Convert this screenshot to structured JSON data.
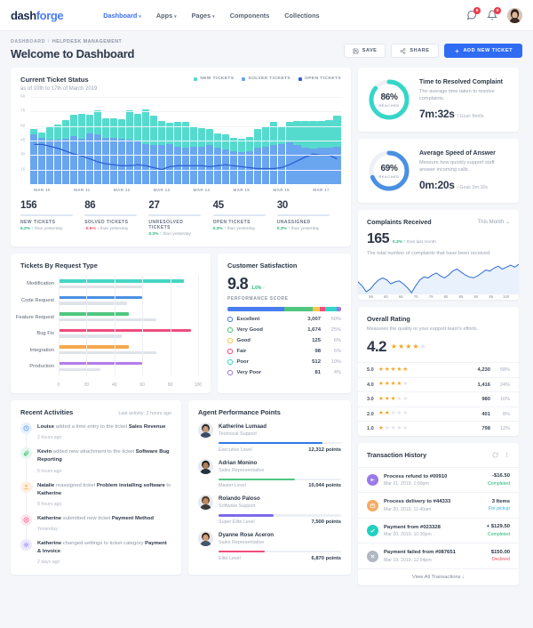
{
  "navbar": {
    "logo_bold": "dash",
    "logo_light": "forge",
    "links": [
      {
        "label": "Dashboard",
        "active": true,
        "caret": true
      },
      {
        "label": "Apps",
        "active": false,
        "caret": true
      },
      {
        "label": "Pages",
        "active": false,
        "caret": true
      },
      {
        "label": "Components",
        "active": false,
        "caret": false
      },
      {
        "label": "Collections",
        "active": false,
        "caret": false
      }
    ],
    "message_badge": "9",
    "bell_badge": "9"
  },
  "page_header": {
    "crumb1": "DASHBOARD",
    "crumb_sep": "/",
    "crumb2": "HELPDESK MANAGEMENT",
    "title": "Welcome to Dashboard",
    "save_label": "SAVE",
    "share_label": "SHARE",
    "add_label": "ADD NEW TICKET"
  },
  "ticket_status": {
    "title": "Current Ticket Status",
    "subtitle": "as of 10th to 17th of March 2019",
    "legend": [
      {
        "label": "NEW TICKETS",
        "color": "#55dbcd"
      },
      {
        "label": "SOLVED TICKETS",
        "color": "#6aa5f0"
      },
      {
        "label": "OPEN TICKETS",
        "color": "#2f5fd0"
      }
    ]
  },
  "chart_data": [
    {
      "type": "bar",
      "title": "Current Ticket Status",
      "subtitle": "as of 10th to 17th of March 2019",
      "xlabel": "",
      "ylabel": "",
      "ylim": [
        0,
        90
      ],
      "yticks": [
        15,
        30,
        45,
        60,
        75,
        90
      ],
      "categories": [
        "MAR 10",
        "MAR 11",
        "MAR 12",
        "MAR 13",
        "MAR 14",
        "MAR 15",
        "MAR 16",
        "MAR 17"
      ],
      "tick_positions": [
        1,
        6,
        11,
        16,
        21,
        26,
        31,
        36
      ],
      "stacked": true,
      "series": [
        {
          "name": "SOLVED TICKETS",
          "color": "#6aa5f0",
          "values": [
            51,
            48,
            46,
            46,
            47,
            50,
            47,
            52,
            51,
            48,
            48,
            47,
            46,
            45,
            41,
            40,
            40,
            41,
            39,
            38,
            39,
            39,
            40,
            38,
            36,
            34,
            33,
            34,
            38,
            39,
            40,
            41,
            43,
            40,
            38,
            37,
            38,
            38,
            39
          ]
        },
        {
          "name": "NEW TICKETS",
          "color": "#55dbcd",
          "values": [
            6,
            5,
            13,
            16,
            19,
            22,
            26,
            20,
            25,
            20,
            20,
            20,
            30,
            28,
            36,
            31,
            25,
            22,
            25,
            26,
            21,
            19,
            17,
            14,
            15,
            14,
            14,
            15,
            19,
            21,
            24,
            19,
            21,
            25,
            27,
            28,
            27,
            28,
            32
          ]
        }
      ],
      "line_series": {
        "name": "OPEN TICKETS",
        "color": "#2f5fd0",
        "values": [
          41,
          41,
          39,
          37,
          34,
          31,
          29,
          26,
          23,
          21,
          20,
          19,
          19,
          20,
          19,
          17,
          15,
          18,
          19,
          19,
          19,
          19,
          18,
          19,
          20,
          19,
          18,
          17,
          16,
          16,
          16,
          17,
          20,
          24,
          28,
          31,
          30,
          30,
          26
        ]
      }
    },
    {
      "type": "line",
      "title": "Complaints Received",
      "xlabel": "",
      "ylabel": "",
      "xticks": [
        "55",
        "60",
        "65",
        "70",
        "75",
        "80",
        "85",
        "90",
        "95",
        "100"
      ],
      "values": [
        48,
        40,
        28,
        33,
        44,
        52,
        56,
        52,
        44,
        48,
        50,
        44,
        36,
        26,
        40,
        52,
        58,
        56,
        62,
        66,
        60,
        56,
        62,
        70,
        74,
        68,
        62,
        58,
        56,
        60,
        66,
        72,
        70,
        76,
        80,
        74,
        78,
        82,
        78,
        84
      ]
    },
    {
      "type": "bar",
      "orientation": "horizontal",
      "title": "Tickets By Request Type",
      "xlim": [
        0,
        100
      ],
      "xticks": [
        0,
        20,
        40,
        60,
        80,
        100
      ],
      "categories": [
        "Modification",
        "Code Request",
        "Feature Request",
        "Bug Fix",
        "Integration",
        "Production"
      ],
      "series": [
        {
          "name": "primary",
          "values": [
            90,
            60,
            50,
            95,
            50,
            60
          ],
          "colors": [
            "#45d6c4",
            "#4a90e2",
            "#4fc77f",
            "#ef4d7e",
            "#f5a84d",
            "#b77ae8"
          ]
        },
        {
          "name": "secondary",
          "values": [
            60,
            49,
            70,
            45,
            70,
            30
          ],
          "color": "#dfe3ea"
        }
      ]
    },
    {
      "type": "bar",
      "title": "Customer Satisfaction",
      "stacked_single": true,
      "categories": [
        "Excellent",
        "Very Good",
        "Good",
        "Fair",
        "Poor",
        "Very Poor"
      ],
      "values": [
        50,
        25,
        6,
        5,
        10,
        4
      ],
      "counts": [
        "3,007",
        "1,674",
        "125",
        "98",
        "512",
        "81"
      ],
      "colors": [
        "#4a7ef0",
        "#4fc77f",
        "#f5c84d",
        "#ef4d7e",
        "#35d6c8",
        "#9b7ae8"
      ]
    },
    {
      "type": "bar",
      "title": "Overall Rating",
      "categories": [
        "5.0",
        "4.0",
        "3.0",
        "2.0",
        "1.0"
      ],
      "values": [
        58,
        24,
        16,
        8,
        12
      ],
      "counts": [
        "4,230",
        "1,416",
        "980",
        "401",
        "798"
      ]
    }
  ],
  "stats": [
    {
      "num": "156",
      "label": "NEW TICKETS",
      "chg": "5.2%",
      "dir": "up",
      "suffix": "than yesterday"
    },
    {
      "num": "86",
      "label": "SOLVED TICKETS",
      "chg": "-0.6%",
      "dir": "down",
      "suffix": "than yesterday"
    },
    {
      "num": "27",
      "label": "UNRESOLVED TICKETS",
      "chg": "0.3%",
      "dir": "up",
      "suffix": "than yesterday"
    },
    {
      "num": "45",
      "label": "OPEN TICKETS",
      "chg": "0.3%",
      "dir": "up",
      "suffix": "than yesterday"
    },
    {
      "num": "30",
      "label": "UNASSIGNED",
      "chg": "0.3%",
      "dir": "up",
      "suffix": "than yesterday"
    }
  ],
  "gauges": [
    {
      "pct": "86%",
      "pct_value": 86,
      "reached": "REACHED",
      "color": "#35d6c8",
      "title": "Time to Resolved Complaint",
      "desc": "The average time taken to resolve complaints.",
      "value": "7m:32s",
      "goal": "/ Goal: 8m0s"
    },
    {
      "pct": "69%",
      "pct_value": 69,
      "reached": "REACHED",
      "color": "#4a90e2",
      "title": "Average Speed of Answer",
      "desc": "Measure how quickly support staff answer incoming calls.",
      "value": "0m:20s",
      "goal": "/ Goal: 0m:10s"
    }
  ],
  "complaints": {
    "title": "Complaints Received",
    "dropdown": "This Month",
    "number": "165",
    "change": "0.3%",
    "change_suffix": "than last month",
    "desc": "The total number of complaints that have been received."
  },
  "overall_rating": {
    "title": "Overall Rating",
    "desc": "Measures the quality or your support team's efforts.",
    "score": "4.2",
    "score_stars": 4,
    "rows": [
      {
        "level": "5.0",
        "stars": 5,
        "count": "4,230",
        "pct": "58%"
      },
      {
        "level": "4.0",
        "stars": 4,
        "count": "1,416",
        "pct": "24%"
      },
      {
        "level": "3.0",
        "stars": 3,
        "count": "980",
        "pct": "16%"
      },
      {
        "level": "2.0",
        "stars": 2,
        "count": "401",
        "pct": "8%"
      },
      {
        "level": "1.0",
        "stars": 1,
        "count": "798",
        "pct": "12%"
      }
    ]
  },
  "transactions": {
    "title": "Transaction History",
    "footer": "View All Transactions",
    "rows": [
      {
        "icon": "arrow-left",
        "icon_color": "#9b7ae8",
        "name": "Process refund to #00910",
        "date": "Mar 21, 2019, 1:00pm",
        "amount": "-$16.50",
        "status": "Completed",
        "status_color": "#23b87a"
      },
      {
        "icon": "box",
        "icon_color": "#f5ab63",
        "name": "Process delivery to #44333",
        "date": "Mar 20, 2019, 11:40am",
        "amount": "3 Items",
        "status": "For pickup",
        "status_color": "#35b8d6"
      },
      {
        "icon": "check",
        "icon_color": "#20cfc0",
        "name": "Payment from #023328",
        "date": "Mar 20, 2019, 10:30pm",
        "amount": "+ $129.50",
        "status": "Completed",
        "status_color": "#23b87a"
      },
      {
        "icon": "cross",
        "icon_color": "#b0b7c3",
        "name": "Payment failed from #087651",
        "date": "Mar 19, 2019, 12:54pm",
        "amount": "$150.00",
        "status": "Declined",
        "status_color": "#ef4c5e"
      }
    ]
  },
  "request_type": {
    "title": "Tickets By Request Type"
  },
  "customer_satisfaction": {
    "title": "Customer Satisfaction",
    "score": "9.8",
    "change": "1.6% ↑",
    "label": "PERFORMANCE SCORE",
    "rows": [
      {
        "name": "Excellent",
        "value": "3,007",
        "pct": "50%",
        "color": "#4a7ef0",
        "width": 50
      },
      {
        "name": "Very Good",
        "value": "1,674",
        "pct": "25%",
        "color": "#4fc77f",
        "width": 25
      },
      {
        "name": "Good",
        "value": "125",
        "pct": "6%",
        "color": "#f5c84d",
        "width": 6
      },
      {
        "name": "Fair",
        "value": "98",
        "pct": "5%",
        "color": "#ef4d7e",
        "width": 5
      },
      {
        "name": "Poor",
        "value": "512",
        "pct": "10%",
        "color": "#35d6c8",
        "width": 10
      },
      {
        "name": "Very Poor",
        "value": "81",
        "pct": "4%",
        "color": "#9b7ae8",
        "width": 4
      }
    ]
  },
  "recent_activities": {
    "title": "Recent Activities",
    "subtitle": "Last activity: 2 hours ago",
    "items": [
      {
        "icon": "clock",
        "bg": "#e8f0fe",
        "fg": "#4a90e2",
        "pre": "Louise",
        "mid": " added a time entry to the ticket ",
        "post": "Sales Revenue",
        "time": "2 hours ago"
      },
      {
        "icon": "paperclip",
        "bg": "#e4f7ed",
        "fg": "#4fc77f",
        "pre": "Kevin",
        "mid": " added new attachment to the ticket ",
        "post": "Software Bug Reporting",
        "time": "5 hours ago"
      },
      {
        "icon": "upload",
        "bg": "#fdf0e0",
        "fg": "#f5a84d",
        "pre": "Natalie",
        "mid": " reassigned ticket ",
        "post": "Problem installing software",
        "tail": " to ",
        "tail2": "Katherine",
        "time": "8 hours ago"
      },
      {
        "icon": "plus-circle",
        "bg": "#fde8f1",
        "fg": "#ef4d7e",
        "pre": "Katherine",
        "mid": " submitted new ticket ",
        "post": "Payment Method",
        "time": "Yesterday"
      },
      {
        "icon": "gear",
        "bg": "#ece8fd",
        "fg": "#7d6ae8",
        "pre": "Katherine",
        "mid": " changed settings to ticket category ",
        "post": "Payment & Invoice",
        "time": "2 days ago"
      }
    ]
  },
  "agent_performance": {
    "title": "Agent Performance Points",
    "agents": [
      {
        "name": "Katherine Lumaad",
        "role": "Technical Support",
        "level": "Executive Level",
        "points": "12,312 points",
        "pct": 85,
        "color": "#2f7ae5",
        "skin": "#c99a78",
        "hair": "#2b2b2b",
        "shirt": "#3a4a66"
      },
      {
        "name": "Adrian Monino",
        "role": "Sales Representative",
        "level": "Master Level",
        "points": "10,044 points",
        "pct": 62,
        "color": "#4fc77f",
        "skin": "#b07c54",
        "hair": "#1c1c1c",
        "shirt": "#26313f"
      },
      {
        "name": "Rolando Paloso",
        "role": "Software Support",
        "level": "Super Elite Level",
        "points": "7,500 points",
        "pct": 45,
        "color": "#7d6ae8",
        "skin": "#c08a60",
        "hair": "#4a3a2a",
        "shirt": "#3b3b3b"
      },
      {
        "name": "Dyanne Rose Aceron",
        "role": "Sales Representative",
        "level": "Elite Level",
        "points": "6,870 points",
        "pct": 38,
        "color": "#ef4d7e",
        "skin": "#d2a07a",
        "hair": "#33241a",
        "shirt": "#44546b"
      }
    ]
  }
}
